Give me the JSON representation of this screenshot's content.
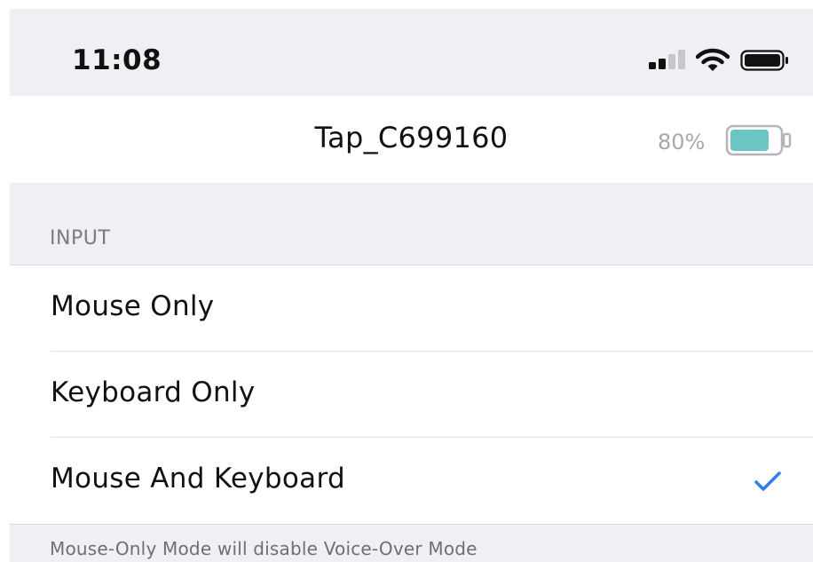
{
  "status_bar": {
    "time": "11:08",
    "icons": [
      "cellular-signal-icon",
      "wifi-icon",
      "battery-icon"
    ]
  },
  "header": {
    "device_name": "Tap_C699160",
    "battery_percent_label": "80%",
    "battery_level": 0.8,
    "battery_color": "#6cc5c5"
  },
  "input_section": {
    "title": "INPUT",
    "options": [
      {
        "label": "Mouse Only",
        "selected": false
      },
      {
        "label": "Keyboard Only",
        "selected": false
      },
      {
        "label": "Mouse And Keyboard",
        "selected": true
      }
    ],
    "footer": "Mouse-Only Mode will disable Voice-Over Mode"
  },
  "colors": {
    "checkmark": "#2f7bf5",
    "grouped_background": "#efeff4"
  }
}
